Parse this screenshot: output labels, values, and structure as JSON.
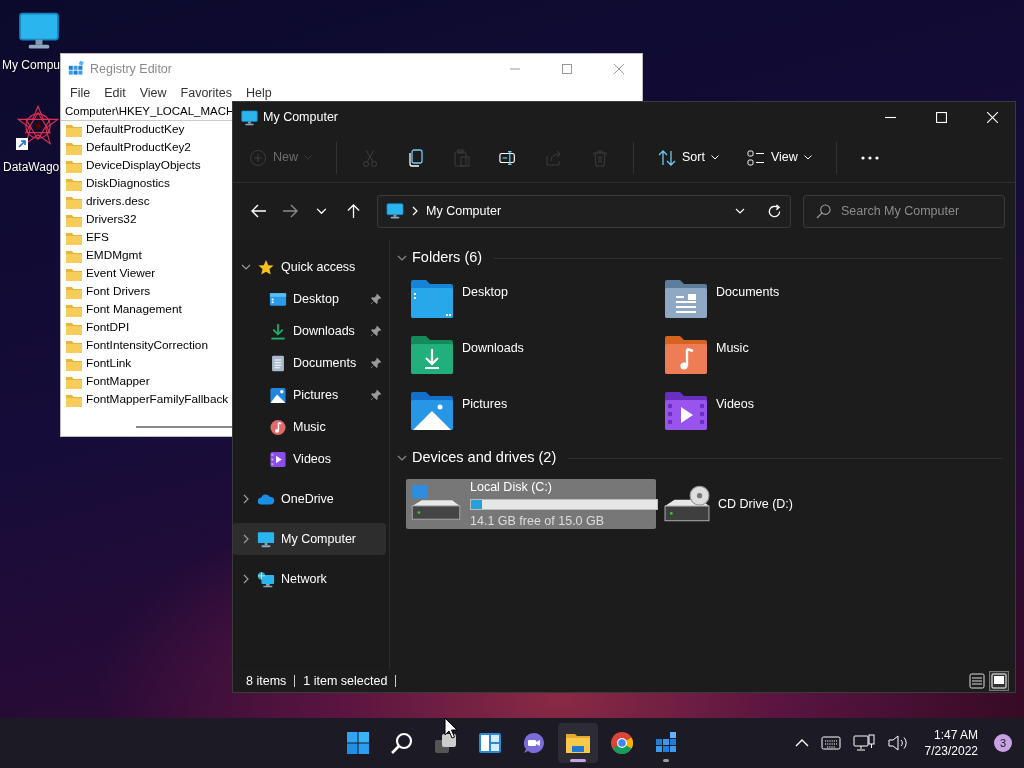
{
  "desktop_icons": [
    {
      "label": "My Compu",
      "kind": "computer"
    },
    {
      "label": "DataWago",
      "kind": "app"
    }
  ],
  "registry_editor": {
    "title": "Registry Editor",
    "menu": [
      "File",
      "Edit",
      "View",
      "Favorites",
      "Help"
    ],
    "address": "Computer\\HKEY_LOCAL_MACH",
    "keys": [
      "DefaultProductKey",
      "DefaultProductKey2",
      "DeviceDisplayObjects",
      "DiskDiagnostics",
      "drivers.desc",
      "Drivers32",
      "EFS",
      "EMDMgmt",
      "Event Viewer",
      "Font Drivers",
      "Font Management",
      "FontDPI",
      "FontIntensityCorrection",
      "FontLink",
      "FontMapper",
      "FontMapperFamilyFallback"
    ]
  },
  "explorer": {
    "title": "My Computer",
    "toolbar": [
      {
        "kind": "new",
        "label": "New",
        "disabled": true
      },
      {
        "kind": "cut",
        "disabled": true
      },
      {
        "kind": "copy",
        "disabled": false
      },
      {
        "kind": "paste",
        "disabled": true
      },
      {
        "kind": "rename",
        "disabled": false
      },
      {
        "kind": "share",
        "disabled": true
      },
      {
        "kind": "delete",
        "disabled": true
      },
      {
        "kind": "sort",
        "label": "Sort",
        "disabled": false
      },
      {
        "kind": "view",
        "label": "View",
        "disabled": false
      },
      {
        "kind": "more",
        "disabled": false
      }
    ],
    "nav_buttons": [
      {
        "kind": "back",
        "disabled": false
      },
      {
        "kind": "forward",
        "disabled": true
      },
      {
        "kind": "recent",
        "disabled": false
      },
      {
        "kind": "up",
        "disabled": false
      }
    ],
    "address": "My Computer",
    "search": {
      "placeholder": "Search My Computer"
    },
    "sidebar": {
      "items": [
        {
          "label": "Quick access",
          "kind": "star",
          "expanded": true,
          "selected": false,
          "children": [
            {
              "label": "Desktop",
              "kind": "desktop",
              "pinned": true,
              "selected": false
            },
            {
              "label": "Downloads",
              "kind": "downloads",
              "pinned": true,
              "selected": false
            },
            {
              "label": "Documents",
              "kind": "documents",
              "pinned": true,
              "selected": false
            },
            {
              "label": "Pictures",
              "kind": "pictures",
              "pinned": true,
              "selected": false
            },
            {
              "label": "Music",
              "kind": "music",
              "pinned": false,
              "selected": false
            },
            {
              "label": "Videos",
              "kind": "videos",
              "pinned": false,
              "selected": false
            }
          ]
        },
        {
          "label": "OneDrive",
          "kind": "cloud",
          "expanded": false,
          "selected": false
        },
        {
          "label": "My Computer",
          "kind": "computer",
          "expanded": false,
          "selected": true
        },
        {
          "label": "Network",
          "kind": "network",
          "expanded": false,
          "selected": false
        }
      ]
    },
    "groups": [
      {
        "title": "Folders (6)",
        "expanded": true,
        "items": [
          {
            "label": "Desktop",
            "kind": "desktop",
            "selected": false
          },
          {
            "label": "Documents",
            "kind": "documents",
            "selected": false
          },
          {
            "label": "Downloads",
            "kind": "downloads",
            "selected": false
          },
          {
            "label": "Music",
            "kind": "music",
            "selected": false
          },
          {
            "label": "Pictures",
            "kind": "pictures",
            "selected": false
          },
          {
            "label": "Videos",
            "kind": "videos",
            "selected": false
          }
        ]
      },
      {
        "title": "Devices and drives (2)",
        "expanded": true,
        "items": [
          {
            "label": "Local Disk (C:)",
            "kind": "disk",
            "selected": true,
            "level": 0.06,
            "free": "14.1 GB free of 15.0 GB"
          },
          {
            "label": "CD Drive (D:)",
            "kind": "cd",
            "selected": false
          }
        ]
      }
    ],
    "status_bar": {
      "count": "8 items",
      "selection": "1 item selected",
      "views": [
        {
          "kind": "details",
          "selected": false
        },
        {
          "kind": "large_icons",
          "selected": true
        }
      ]
    }
  },
  "taskbar": {
    "apps": [
      {
        "kind": "start",
        "selected": false,
        "running": false
      },
      {
        "kind": "search",
        "selected": false,
        "running": false
      },
      {
        "kind": "task_view",
        "selected": false,
        "running": false
      },
      {
        "kind": "widgets",
        "selected": false,
        "running": false
      },
      {
        "kind": "chat",
        "selected": false,
        "running": false
      },
      {
        "kind": "explorer",
        "selected": true,
        "running": true
      },
      {
        "kind": "chrome",
        "selected": false,
        "running": false
      },
      {
        "kind": "registry",
        "selected": false,
        "running": true
      }
    ],
    "tray": {
      "time": "1:47 AM",
      "date": "7/23/2022",
      "notifications": "3"
    }
  }
}
